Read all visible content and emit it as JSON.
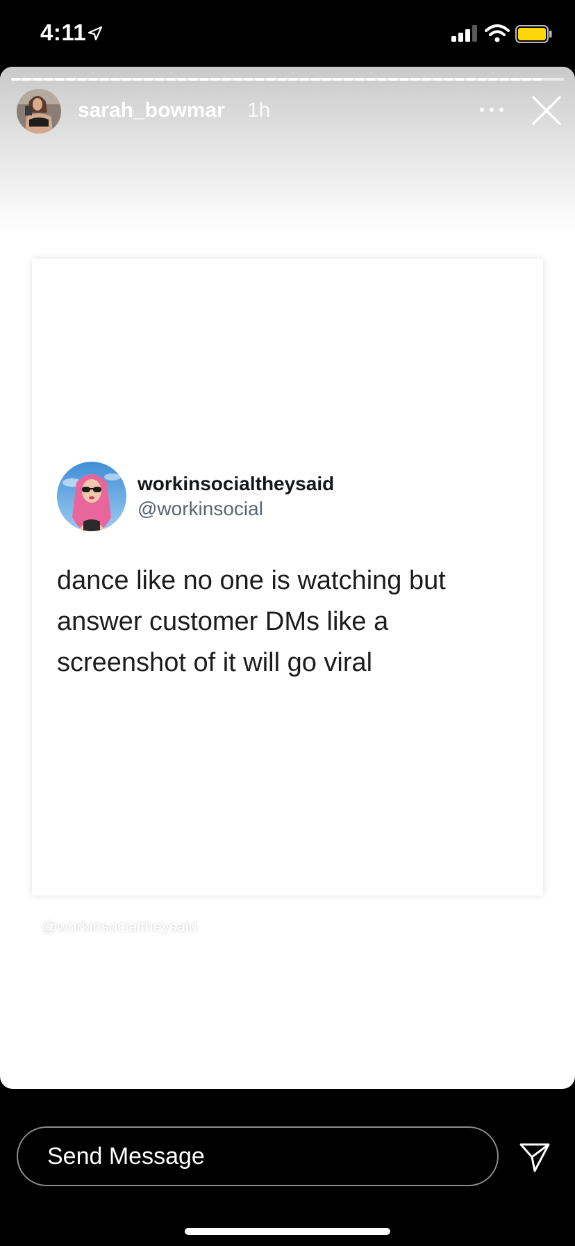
{
  "status_bar": {
    "time": "4:11",
    "icons": [
      "location-arrow-icon",
      "cellular-signal-icon",
      "wifi-icon",
      "battery-icon"
    ],
    "battery_color": "#FFD60A"
  },
  "story": {
    "username": "sarah_bowmar",
    "time_ago": "1h",
    "icons": [
      "more-icon",
      "close-icon"
    ]
  },
  "tweet": {
    "display_name": "workinsocialtheysaid",
    "handle": "@workinsocial",
    "text": "dance like no one is watching but answer customer DMs like a screenshot of it will go viral"
  },
  "watermark": "@workinsocialtheysaid",
  "footer": {
    "message_placeholder": "Send Message",
    "icons": [
      "send-icon"
    ]
  }
}
